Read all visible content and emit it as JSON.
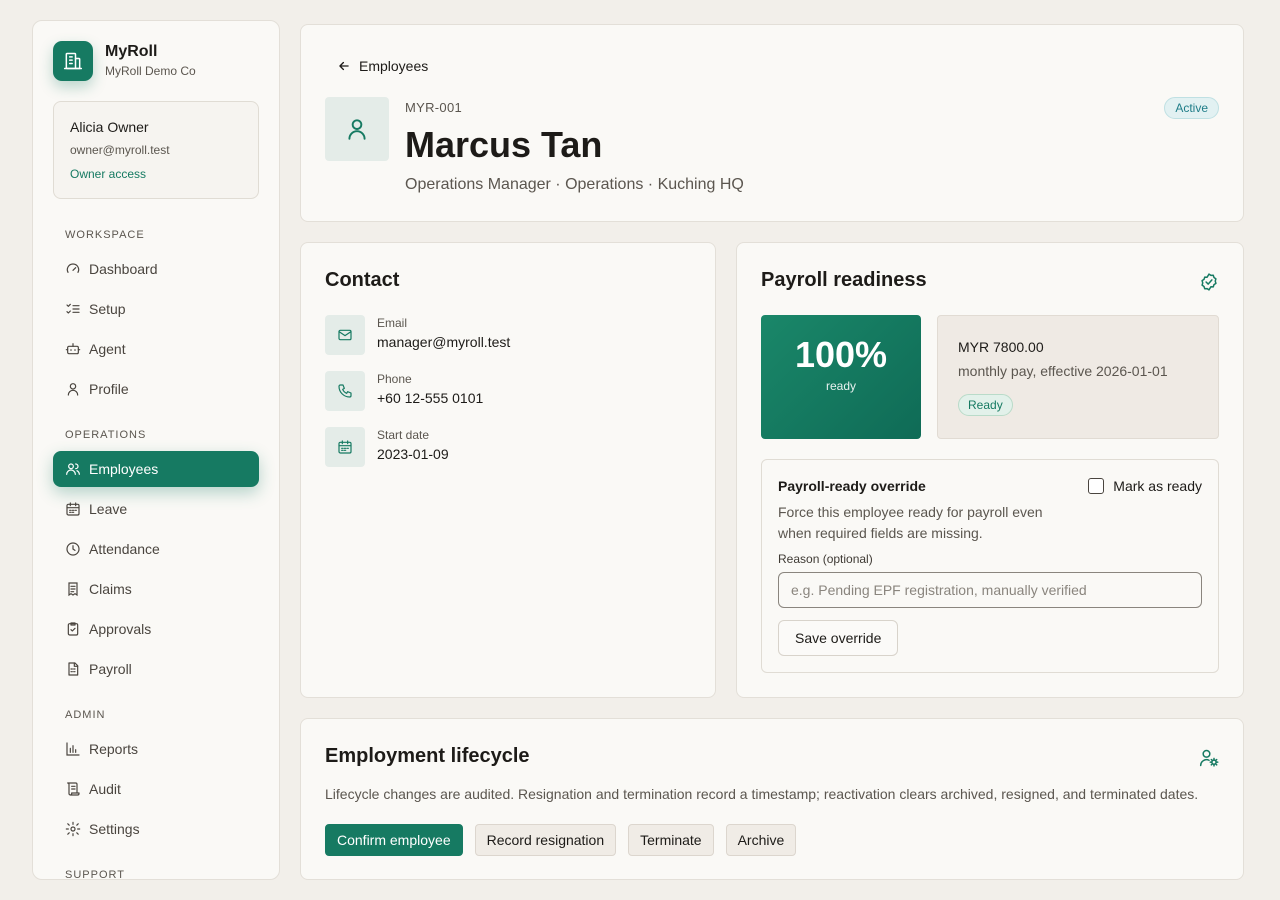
{
  "app": {
    "name": "MyRoll",
    "company": "MyRoll Demo Co"
  },
  "user": {
    "name": "Alicia Owner",
    "email": "owner@myroll.test",
    "access": "Owner access"
  },
  "nav": {
    "workspace_label": "WORKSPACE",
    "workspace": [
      {
        "label": "Dashboard",
        "icon": "gauge-icon"
      },
      {
        "label": "Setup",
        "icon": "checklist-icon"
      },
      {
        "label": "Agent",
        "icon": "bot-icon"
      },
      {
        "label": "Profile",
        "icon": "user-icon"
      }
    ],
    "operations_label": "OPERATIONS",
    "operations": [
      {
        "label": "Employees",
        "icon": "users-icon",
        "active": true
      },
      {
        "label": "Leave",
        "icon": "calendar-icon"
      },
      {
        "label": "Attendance",
        "icon": "clock-icon"
      },
      {
        "label": "Claims",
        "icon": "receipt-icon"
      },
      {
        "label": "Approvals",
        "icon": "clipboard-check-icon"
      },
      {
        "label": "Payroll",
        "icon": "file-spreadsheet-icon"
      }
    ],
    "admin_label": "ADMIN",
    "admin": [
      {
        "label": "Reports",
        "icon": "bar-chart-icon"
      },
      {
        "label": "Audit",
        "icon": "scroll-icon"
      },
      {
        "label": "Settings",
        "icon": "gear-icon"
      }
    ],
    "support_label": "SUPPORT"
  },
  "employee": {
    "back_label": "Employees",
    "id": "MYR-001",
    "name": "Marcus Tan",
    "meta": "Operations Manager · Operations · Kuching HQ",
    "status": "Active"
  },
  "contact": {
    "title": "Contact",
    "items": [
      {
        "label": "Email",
        "value": "manager@myroll.test",
        "icon": "mail-icon"
      },
      {
        "label": "Phone",
        "value": "+60 12-555 0101",
        "icon": "phone-icon"
      },
      {
        "label": "Start date",
        "value": "2023-01-09",
        "icon": "calendar-icon"
      }
    ]
  },
  "payroll": {
    "title": "Payroll readiness",
    "percent": "100%",
    "percent_label": "ready",
    "amount": "MYR 7800.00",
    "pay_desc": "monthly pay, effective 2026-01-01",
    "badge": "Ready",
    "override": {
      "title": "Payroll-ready override",
      "description": "Force this employee ready for payroll even when required fields are missing.",
      "checkbox_label": "Mark as ready",
      "reason_label": "Reason (optional)",
      "reason_placeholder": "e.g. Pending EPF registration, manually verified",
      "reason_value": "",
      "save_label": "Save override"
    }
  },
  "lifecycle": {
    "title": "Employment lifecycle",
    "description": "Lifecycle changes are audited. Resignation and termination record a timestamp; reactivation clears archived, resigned, and terminated dates.",
    "actions": [
      "Confirm employee",
      "Record resignation",
      "Terminate",
      "Archive"
    ]
  },
  "colors": {
    "accent": "#167a62",
    "background": "#f2efea",
    "card": "#faf9f6",
    "status_active": "#1f7d88"
  }
}
